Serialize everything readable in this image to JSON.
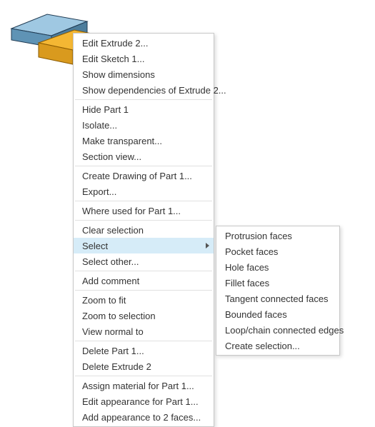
{
  "main_menu": {
    "g1": [
      "Edit Extrude 2...",
      "Edit Sketch 1...",
      "Show dimensions",
      "Show dependencies of Extrude 2..."
    ],
    "g2": [
      "Hide Part 1",
      "Isolate...",
      "Make transparent...",
      "Section view..."
    ],
    "g3": [
      "Create Drawing of Part 1...",
      "Export..."
    ],
    "g4": [
      "Where used for Part 1..."
    ],
    "g5": [
      "Clear selection"
    ],
    "select_label": "Select",
    "g6": [
      "Select other..."
    ],
    "g7": [
      "Add comment"
    ],
    "g8": [
      "Zoom to fit",
      "Zoom to selection",
      "View normal to"
    ],
    "g9": [
      "Delete Part 1...",
      "Delete Extrude 2"
    ],
    "g10": [
      "Assign material for Part 1...",
      "Edit appearance for Part 1...",
      "Add appearance to 2 faces..."
    ]
  },
  "sub_menu": {
    "items": [
      "Protrusion faces",
      "Pocket faces",
      "Hole faces",
      "Fillet faces",
      "Tangent connected faces",
      "Bounded faces",
      "Loop/chain connected edges",
      "Create selection..."
    ]
  }
}
